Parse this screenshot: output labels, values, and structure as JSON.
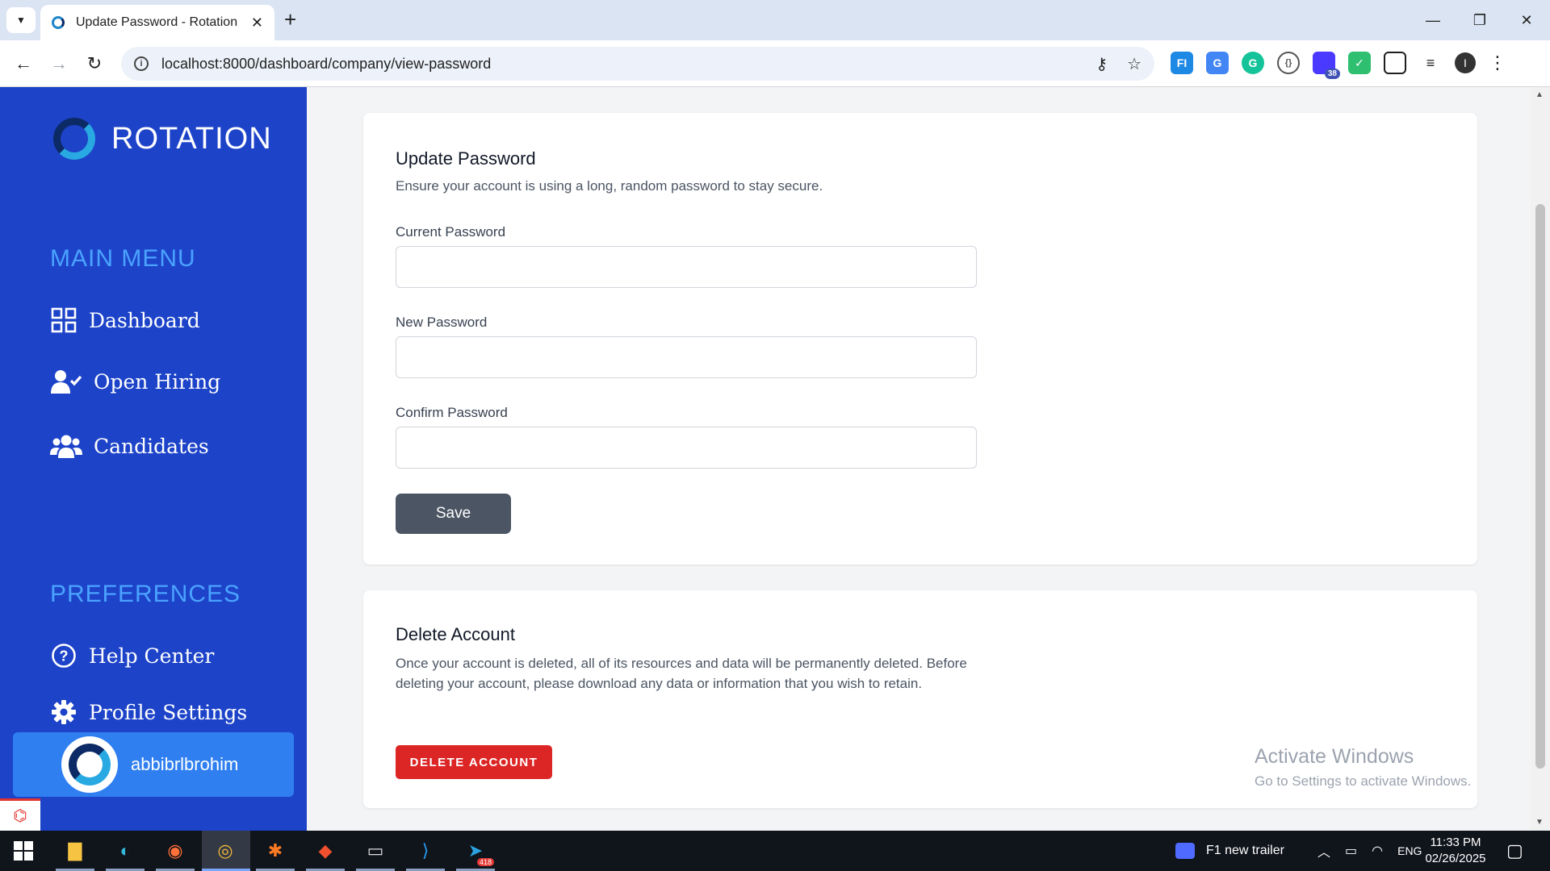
{
  "browser": {
    "tab_title": "Update Password - Rotation",
    "url": "localhost:8000/dashboard/company/view-password",
    "extensions": [
      {
        "name": "fi-icon",
        "label": "FI",
        "color": "#1e88e5"
      },
      {
        "name": "translate-icon",
        "label": "G",
        "color": "#4285f4"
      },
      {
        "name": "grammarly-icon",
        "label": "G",
        "color": "#15c39a"
      },
      {
        "name": "code-icon",
        "label": "{}",
        "color": "#555555"
      },
      {
        "name": "graduation-icon",
        "label": "",
        "color": "#4a3aff",
        "badge": "38"
      },
      {
        "name": "shield-check-icon",
        "label": "✓",
        "color": "#2fbf71"
      },
      {
        "name": "puzzle-icon",
        "label": "",
        "color": "#ffffff"
      }
    ],
    "profile_initial": "I"
  },
  "sidebar": {
    "brand": "ROTATION",
    "main_menu_title": "MAIN MENU",
    "main_items": [
      {
        "label": "Dashboard",
        "icon": "grid-icon"
      },
      {
        "label": "Open Hiring",
        "icon": "user-check-icon"
      },
      {
        "label": "Candidates",
        "icon": "users-icon"
      }
    ],
    "preferences_title": "PREFERENCES",
    "pref_items": [
      {
        "label": "Help Center",
        "icon": "help-circle-icon"
      },
      {
        "label": "Profile Settings",
        "icon": "gear-icon"
      }
    ],
    "user_name": "abbibrlbrohim"
  },
  "update_password": {
    "title": "Update Password",
    "description": "Ensure your account is using a long, random password to stay secure.",
    "current_label": "Current Password",
    "current_value": "",
    "new_label": "New Password",
    "new_value": "",
    "confirm_label": "Confirm Password",
    "confirm_value": "",
    "save_label": "Save"
  },
  "delete_account": {
    "title": "Delete Account",
    "description": "Once your account is deleted, all of its resources and data will be permanently deleted. Before deleting your account, please download any data or information that you wish to retain.",
    "button_label": "DELETE ACCOUNT"
  },
  "watermark": {
    "title": "Activate Windows",
    "subtitle": "Go to Settings to activate Windows."
  },
  "taskbar": {
    "telegram_badge": "418",
    "news": "F1 new trailer",
    "language": "ENG",
    "time": "11:33 PM",
    "date": "02/26/2025"
  }
}
